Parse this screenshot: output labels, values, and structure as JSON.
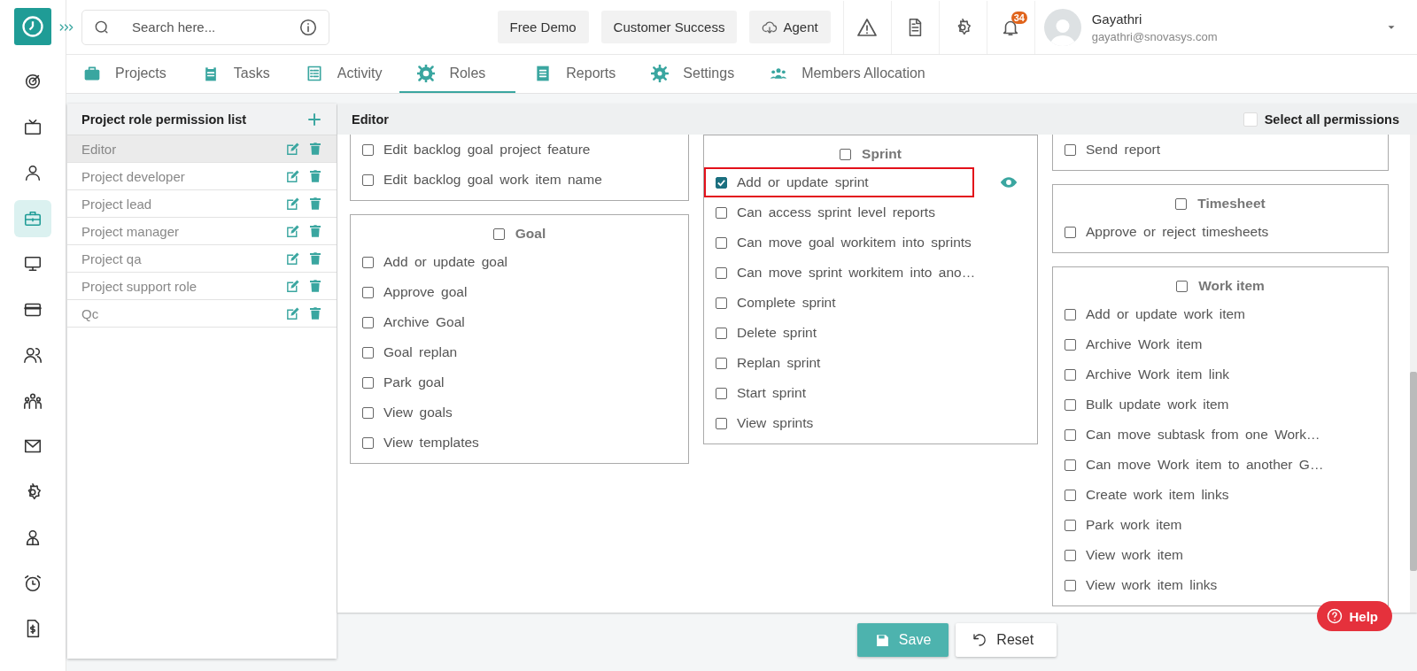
{
  "search": {
    "placeholder": "Search here..."
  },
  "top_buttons": [
    {
      "label": "Free Demo",
      "kind": "plain"
    },
    {
      "label": "Customer Success",
      "kind": "plain"
    },
    {
      "label": "Agent",
      "kind": "cloud"
    }
  ],
  "notifications": {
    "count": "34"
  },
  "user": {
    "name": "Gayathri",
    "email": "gayathri@snovasys.com"
  },
  "nav": [
    {
      "selected": false
    },
    {
      "selected": false
    },
    {
      "selected": false
    },
    {
      "selected": true
    },
    {
      "selected": false
    },
    {
      "selected": false
    },
    {
      "selected": false
    },
    {
      "selected": false
    },
    {
      "selected": false
    },
    {
      "selected": false
    },
    {
      "selected": false
    },
    {
      "selected": false
    },
    {
      "selected": false
    }
  ],
  "tabs": [
    {
      "label": "Projects",
      "selected": false
    },
    {
      "label": "Tasks",
      "selected": false
    },
    {
      "label": "Activity",
      "selected": false
    },
    {
      "label": "Roles",
      "selected": true
    },
    {
      "label": "Reports",
      "selected": false
    },
    {
      "label": "Settings",
      "selected": false
    },
    {
      "label": "Members Allocation",
      "selected": false
    }
  ],
  "role_list": {
    "title": "Project role permission list",
    "roles": [
      {
        "name": "Editor",
        "selected": true
      },
      {
        "name": "Project developer",
        "selected": false
      },
      {
        "name": "Project lead",
        "selected": false
      },
      {
        "name": "Project manager",
        "selected": false
      },
      {
        "name": "Project qa",
        "selected": false
      },
      {
        "name": "Project support role",
        "selected": false
      },
      {
        "name": "Qc",
        "selected": false
      }
    ]
  },
  "editor": {
    "title": "Editor",
    "select_all": {
      "label": "Select all permissions",
      "checked": false
    },
    "columns": [
      {
        "cards": [
          {
            "items": [
              {
                "label": "Edit backlog goal project feature",
                "checked": false,
                "highlighted": false
              },
              {
                "label": "Edit backlog goal work item name",
                "checked": false,
                "highlighted": false
              }
            ]
          },
          {
            "title": "Goal",
            "checked": false,
            "items": [
              {
                "label": "Add or update goal",
                "checked": false,
                "highlighted": false
              },
              {
                "label": "Approve goal",
                "checked": false,
                "highlighted": false
              },
              {
                "label": "Archive Goal",
                "checked": false,
                "highlighted": false
              },
              {
                "label": "Goal replan",
                "checked": false,
                "highlighted": false
              },
              {
                "label": "Park goal",
                "checked": false,
                "highlighted": false
              },
              {
                "label": "View goals",
                "checked": false,
                "highlighted": false
              },
              {
                "label": "View templates",
                "checked": false,
                "highlighted": false
              }
            ]
          }
        ]
      },
      {
        "cards": [
          {
            "title": "Sprint",
            "checked": false,
            "items": [
              {
                "label": "Add or update sprint",
                "checked": true,
                "highlighted": true
              },
              {
                "label": "Can access sprint level reports",
                "checked": false,
                "highlighted": false
              },
              {
                "label": "Can move goal workitem into sprints",
                "checked": false,
                "highlighted": false
              },
              {
                "label": "Can move sprint workitem into ano…",
                "checked": false,
                "highlighted": false
              },
              {
                "label": "Complete sprint",
                "checked": false,
                "highlighted": false
              },
              {
                "label": "Delete sprint",
                "checked": false,
                "highlighted": false
              },
              {
                "label": "Replan sprint",
                "checked": false,
                "highlighted": false
              },
              {
                "label": "Start sprint",
                "checked": false,
                "highlighted": false
              },
              {
                "label": "View sprints",
                "checked": false,
                "highlighted": false
              }
            ]
          }
        ]
      },
      {
        "cards": [
          {
            "items": [
              {
                "label": "Send report",
                "checked": false,
                "highlighted": false
              }
            ]
          },
          {
            "title": "Timesheet",
            "checked": false,
            "items": [
              {
                "label": "Approve or reject timesheets",
                "checked": false,
                "highlighted": false
              }
            ]
          },
          {
            "title": "Work item",
            "checked": false,
            "items": [
              {
                "label": "Add or update work item",
                "checked": false,
                "highlighted": false
              },
              {
                "label": "Archive Work item",
                "checked": false,
                "highlighted": false
              },
              {
                "label": "Archive Work item link",
                "checked": false,
                "highlighted": false
              },
              {
                "label": "Bulk update work item",
                "checked": false,
                "highlighted": false
              },
              {
                "label": "Can move subtask from one Work…",
                "checked": false,
                "highlighted": false
              },
              {
                "label": "Can move Work item to another G…",
                "checked": false,
                "highlighted": false
              },
              {
                "label": "Create work item links",
                "checked": false,
                "highlighted": false
              },
              {
                "label": "Park work item",
                "checked": false,
                "highlighted": false
              },
              {
                "label": "View work item",
                "checked": false,
                "highlighted": false
              },
              {
                "label": "View work item links",
                "checked": false,
                "highlighted": false
              }
            ]
          }
        ]
      }
    ]
  },
  "buttons": [
    {
      "label": "Save",
      "kind": "primary"
    },
    {
      "label": "Reset",
      "kind": "secondary"
    }
  ],
  "help": {
    "label": "Help"
  }
}
